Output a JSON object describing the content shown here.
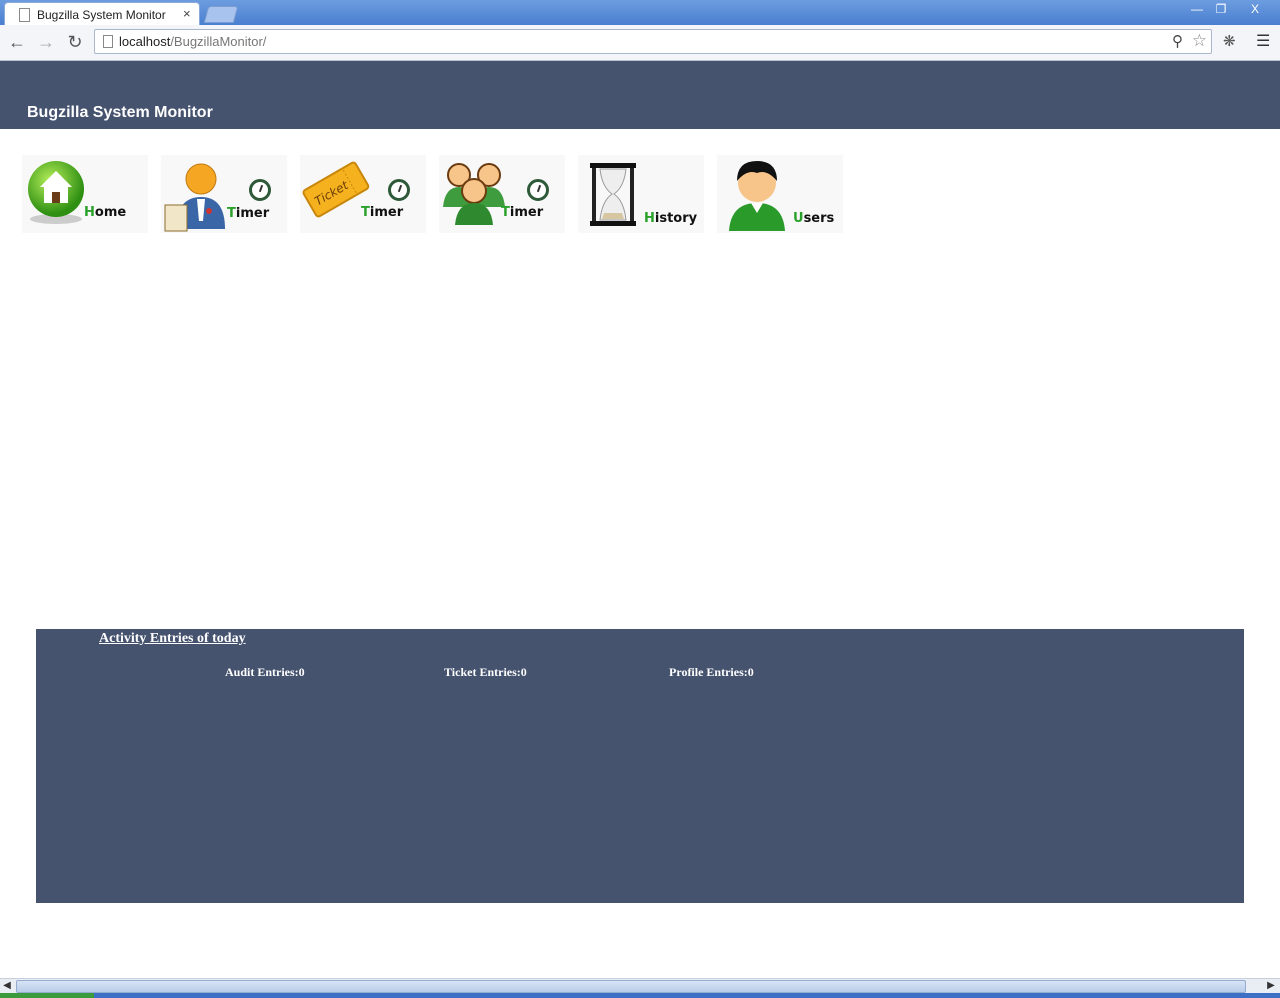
{
  "browser": {
    "tab_title": "Bugzilla System Monitor",
    "tab_close": "×",
    "url_host": "localhost",
    "url_path": "/BugzillaMonitor/",
    "win_minimize": "—",
    "win_restore": "❐",
    "win_close": "X"
  },
  "header": {
    "title": "Bugzilla System Monitor"
  },
  "nav": {
    "home": {
      "first": "H",
      "rest": "ome"
    },
    "user_timer": {
      "first": "T",
      "rest": "imer"
    },
    "ticket_timer": {
      "first": "T",
      "rest": "imer",
      "ticket_text": "Ticket"
    },
    "group_timer": {
      "first": "T",
      "rest": "imer"
    },
    "history": {
      "first": "H",
      "rest": "istory"
    },
    "users": {
      "first": "U",
      "rest": "sers"
    }
  },
  "activity": {
    "link": "Activity Entries of today",
    "audit": "Audit Entries:0",
    "ticket": "Ticket Entries:0",
    "profile": "Profile Entries:0"
  },
  "icons": {
    "home": "house-icon",
    "user_timer": "person-clock-icon",
    "ticket_timer": "ticket-clock-icon",
    "group_timer": "group-clock-icon",
    "history": "hourglass-icon",
    "users": "user-icon"
  },
  "colors": {
    "header_bg": "#45536f",
    "accent_green": "#2aa12a"
  }
}
